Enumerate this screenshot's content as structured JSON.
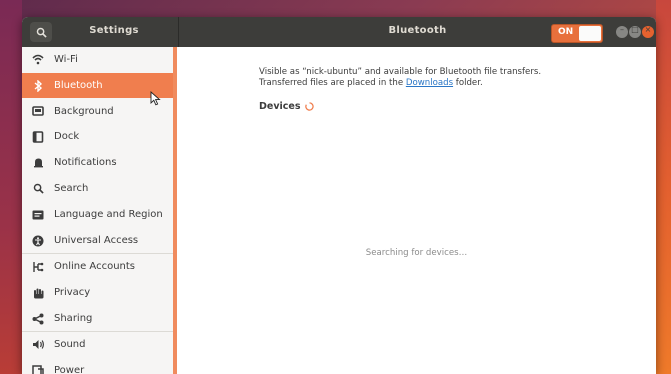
{
  "window": {
    "sidebar_title": "Settings",
    "panel_title": "Bluetooth",
    "toggle_label": "ON"
  },
  "sidebar": {
    "items": [
      {
        "label": "Wi-Fi",
        "icon": "wifi-icon"
      },
      {
        "label": "Bluetooth",
        "icon": "bluetooth-icon",
        "active": true
      },
      {
        "label": "Background",
        "icon": "background-icon"
      },
      {
        "label": "Dock",
        "icon": "dock-icon"
      },
      {
        "label": "Notifications",
        "icon": "bell-icon"
      },
      {
        "label": "Search",
        "icon": "search-icon"
      },
      {
        "label": "Language and Region",
        "icon": "language-icon"
      },
      {
        "label": "Universal Access",
        "icon": "accessibility-icon"
      },
      {
        "label": "Online Accounts",
        "icon": "online-accounts-icon"
      },
      {
        "label": "Privacy",
        "icon": "privacy-hand-icon"
      },
      {
        "label": "Sharing",
        "icon": "share-icon"
      },
      {
        "label": "Sound",
        "icon": "speaker-icon"
      },
      {
        "label": "Power",
        "icon": "power-icon"
      }
    ]
  },
  "content": {
    "visibility_text": "Visible as “nick-ubuntu” and available for Bluetooth file transfers.",
    "transfer_prefix": "Transferred files are placed in the ",
    "transfer_link": "Downloads",
    "transfer_suffix": " folder.",
    "devices_heading": "Devices",
    "searching_text": "Searching for devices…"
  },
  "colors": {
    "accent": "#f07e4e",
    "titlebar": "#3d3d3a",
    "link": "#2a76c6"
  }
}
